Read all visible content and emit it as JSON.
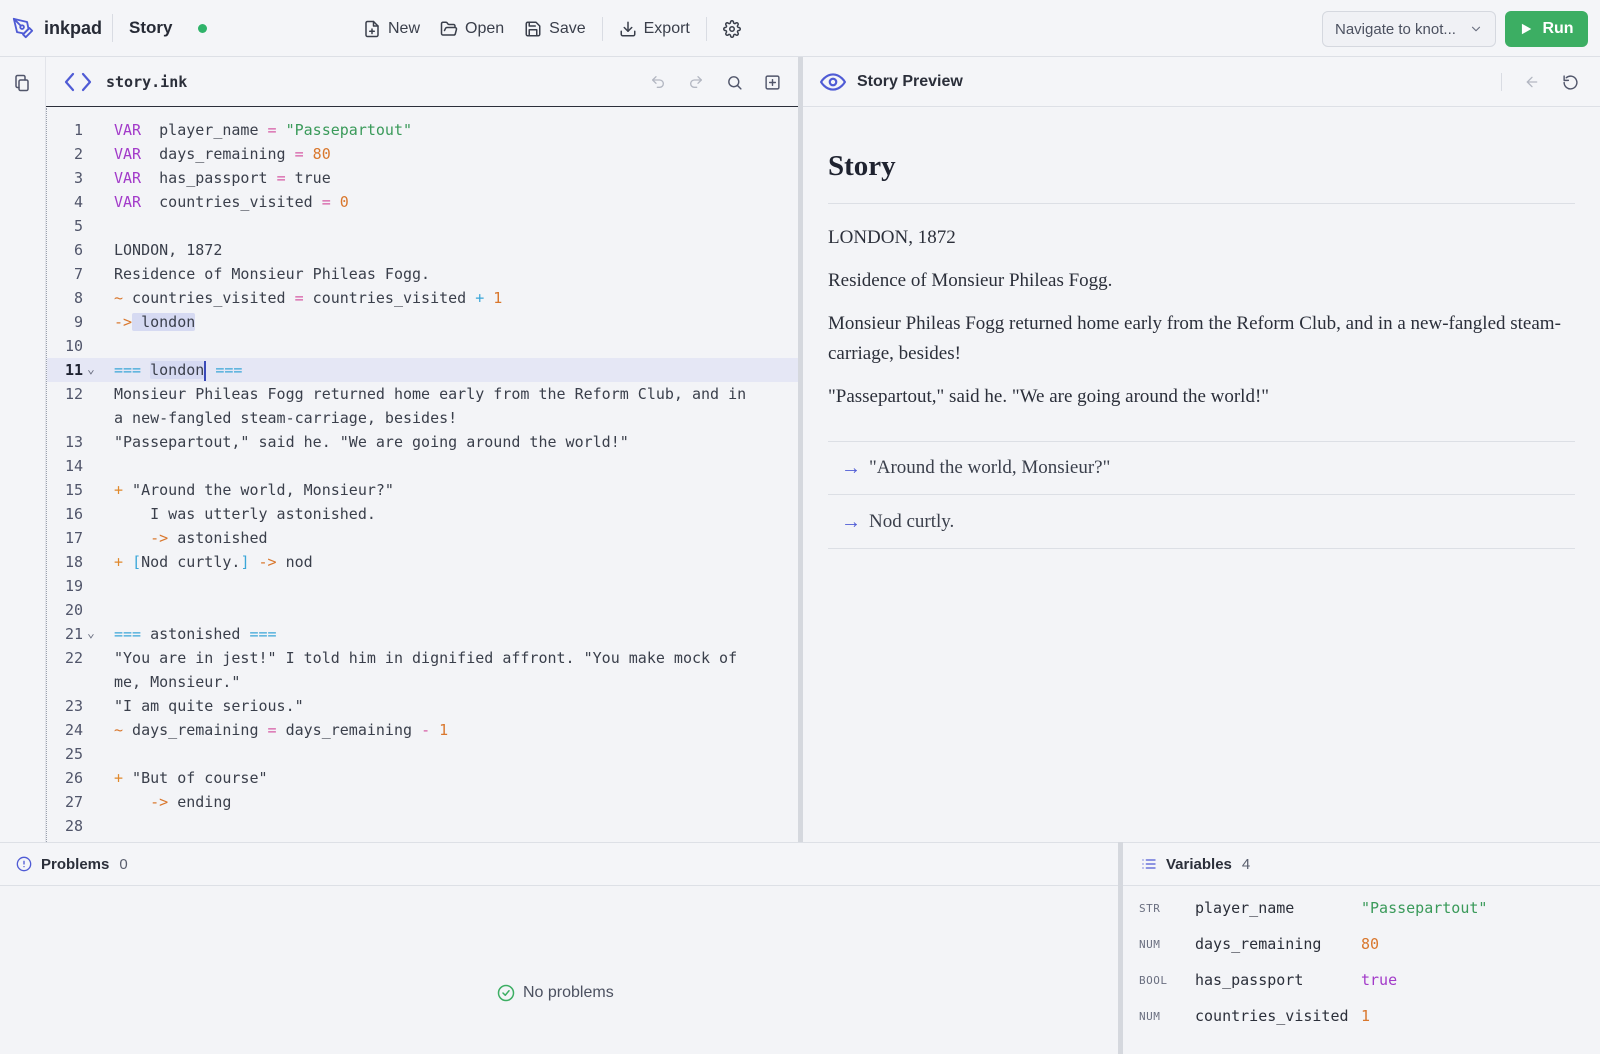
{
  "app": {
    "name": "inkpad",
    "story_name": "Story",
    "status_color": "#2fb36a",
    "accent_color": "#4f5bd5",
    "run_color": "#3cae63"
  },
  "toolbar": {
    "new_label": "New",
    "open_label": "Open",
    "save_label": "Save",
    "export_label": "Export",
    "navigate_placeholder": "Navigate to knot...",
    "run_label": "Run"
  },
  "editor": {
    "file_name": "story.ink",
    "active_line": 11,
    "lines": [
      {
        "n": "1",
        "tokens": [
          [
            "kw",
            "VAR"
          ],
          [
            "",
            "  player_name "
          ],
          [
            "eqop",
            "="
          ],
          [
            "",
            ""
          ],
          [
            "str",
            " \"Passepartout\""
          ]
        ]
      },
      {
        "n": "2",
        "tokens": [
          [
            "kw",
            "VAR"
          ],
          [
            "",
            "  days_remaining "
          ],
          [
            "eqop",
            "="
          ],
          [
            "num",
            " 80"
          ]
        ]
      },
      {
        "n": "3",
        "tokens": [
          [
            "kw",
            "VAR"
          ],
          [
            "",
            "  has_passport "
          ],
          [
            "eqop",
            "="
          ],
          [
            "",
            " true"
          ]
        ]
      },
      {
        "n": "4",
        "tokens": [
          [
            "kw",
            "VAR"
          ],
          [
            "",
            "  countries_visited "
          ],
          [
            "eqop",
            "="
          ],
          [
            "num",
            " 0"
          ]
        ]
      },
      {
        "n": "5",
        "tokens": []
      },
      {
        "n": "6",
        "tokens": [
          [
            "",
            "LONDON, 1872"
          ]
        ]
      },
      {
        "n": "7",
        "tokens": [
          [
            "",
            "Residence of Monsieur Phileas Fogg."
          ]
        ]
      },
      {
        "n": "8",
        "tokens": [
          [
            "tilde",
            "~"
          ],
          [
            "",
            " countries_visited "
          ],
          [
            "eqop",
            "="
          ],
          [
            "",
            " countries_visited "
          ],
          [
            "knot",
            "+"
          ],
          [
            "num",
            " 1"
          ]
        ]
      },
      {
        "n": "9",
        "tokens": [
          [
            "op",
            "->"
          ],
          [
            "",
            ""
          ],
          [
            "hl",
            " london"
          ]
        ]
      },
      {
        "n": "10",
        "tokens": []
      },
      {
        "n": "11",
        "fold": true,
        "tokens": [
          [
            "knot",
            "==="
          ],
          [
            "",
            " "
          ],
          [
            "hlc",
            "london"
          ],
          [
            "",
            " "
          ],
          [
            "knot",
            "==="
          ]
        ]
      },
      {
        "n": "12",
        "tokens": [
          [
            "",
            "Monsieur Phileas Fogg returned home early from the Reform Club, and in"
          ]
        ]
      },
      {
        "n": "",
        "tokens": [
          [
            "",
            "a new-fangled steam-carriage, besides!"
          ]
        ]
      },
      {
        "n": "13",
        "tokens": [
          [
            "",
            "\"Passepartout,\" said he. \"We are going around the world!\""
          ]
        ]
      },
      {
        "n": "14",
        "tokens": []
      },
      {
        "n": "15",
        "tokens": [
          [
            "plus",
            "+"
          ],
          [
            "",
            " \"Around the world, Monsieur?\""
          ]
        ]
      },
      {
        "n": "16",
        "tokens": [
          [
            "",
            "    I was utterly astonished."
          ]
        ]
      },
      {
        "n": "17",
        "tokens": [
          [
            "",
            "    "
          ],
          [
            "op",
            "->"
          ],
          [
            "",
            " astonished"
          ]
        ]
      },
      {
        "n": "18",
        "tokens": [
          [
            "plus",
            "+"
          ],
          [
            "",
            " "
          ],
          [
            "brk",
            "["
          ],
          [
            "",
            "Nod curtly."
          ],
          [
            "brk",
            "]"
          ],
          [
            "",
            " "
          ],
          [
            "op",
            "->"
          ],
          [
            "",
            " nod"
          ]
        ]
      },
      {
        "n": "19",
        "tokens": []
      },
      {
        "n": "20",
        "tokens": []
      },
      {
        "n": "21",
        "fold": true,
        "tokens": [
          [
            "knot",
            "==="
          ],
          [
            "",
            " astonished "
          ],
          [
            "knot",
            "==="
          ]
        ]
      },
      {
        "n": "22",
        "tokens": [
          [
            "",
            "\"You are in jest!\" I told him in dignified affront. \"You make mock of"
          ]
        ]
      },
      {
        "n": "",
        "tokens": [
          [
            "",
            "me, Monsieur.\""
          ]
        ]
      },
      {
        "n": "23",
        "tokens": [
          [
            "",
            "\"I am quite serious.\""
          ]
        ]
      },
      {
        "n": "24",
        "tokens": [
          [
            "tilde",
            "~"
          ],
          [
            "",
            " days_remaining "
          ],
          [
            "eqop",
            "="
          ],
          [
            "",
            " days_remaining "
          ],
          [
            "eqop",
            "-"
          ],
          [
            "num",
            " 1"
          ]
        ]
      },
      {
        "n": "25",
        "tokens": []
      },
      {
        "n": "26",
        "tokens": [
          [
            "plus",
            "+"
          ],
          [
            "",
            " \"But of course\""
          ]
        ]
      },
      {
        "n": "27",
        "tokens": [
          [
            "",
            "    "
          ],
          [
            "op",
            "->"
          ],
          [
            "",
            " ending"
          ]
        ]
      },
      {
        "n": "28",
        "tokens": []
      }
    ]
  },
  "preview": {
    "header_title": "Story Preview",
    "story_title": "Story",
    "paragraphs": [
      "LONDON, 1872",
      "Residence of Monsieur Phileas Fogg.",
      "Monsieur Phileas Fogg returned home early from the Reform Club, and in a new-fangled steam-carriage, besides!",
      "\"Passepartout,\" said he. \"We are going around the world!\""
    ],
    "choice_arrow": "→",
    "choices": [
      "\"Around the world, Monsieur?\"",
      "Nod curtly."
    ]
  },
  "problems": {
    "title": "Problems",
    "count": "0",
    "empty_text": "No problems"
  },
  "variables": {
    "title": "Variables",
    "count": "4",
    "items": [
      {
        "type": "STR",
        "name": "player_name",
        "value": "\"Passepartout\"",
        "kind": "str"
      },
      {
        "type": "NUM",
        "name": "days_remaining",
        "value": "80",
        "kind": "num"
      },
      {
        "type": "BOOL",
        "name": "has_passport",
        "value": "true",
        "kind": "bool"
      },
      {
        "type": "NUM",
        "name": "countries_visited",
        "value": "1",
        "kind": "num"
      }
    ]
  }
}
